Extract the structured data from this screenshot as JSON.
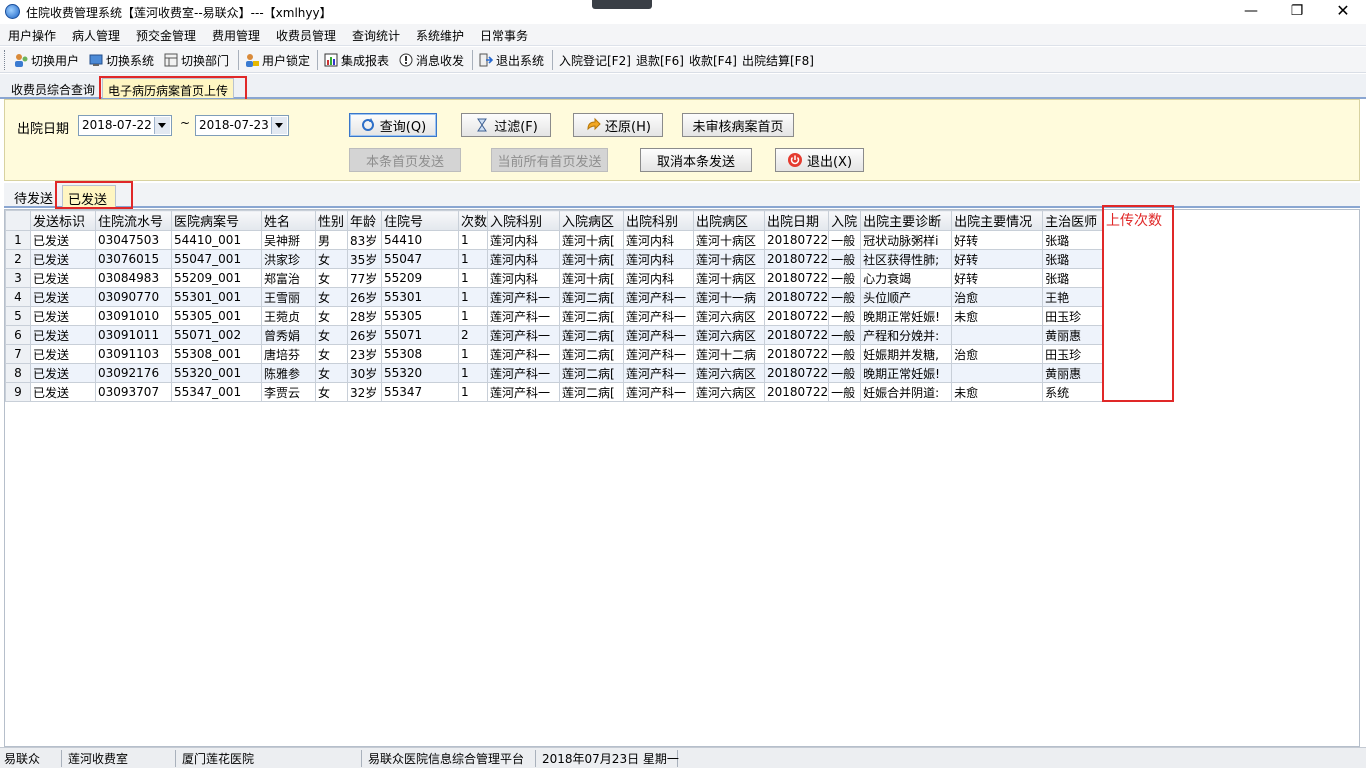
{
  "window": {
    "title": "住院收费管理系统【莲河收费室--易联众】---【xmlhyy】",
    "minimize": "—",
    "maximize": "❐",
    "close": "✕"
  },
  "menu": [
    "用户操作",
    "病人管理",
    "预交金管理",
    "费用管理",
    "收费员管理",
    "查询统计",
    "系统维护",
    "日常事务"
  ],
  "toolbar": [
    {
      "label": "切换用户",
      "icon": "switch-user-icon"
    },
    {
      "label": "切换系统",
      "icon": "switch-system-icon"
    },
    {
      "label": "切换部门",
      "icon": "switch-department-icon"
    },
    {
      "label": "用户锁定",
      "icon": "user-lock-icon"
    },
    {
      "label": "集成报表",
      "icon": "report-icon"
    },
    {
      "label": "消息收发",
      "icon": "message-icon"
    },
    {
      "label": "退出系统",
      "icon": "exit-icon"
    },
    {
      "label": "入院登记[F2]"
    },
    {
      "label": "退款[F6]"
    },
    {
      "label": "收款[F4]"
    },
    {
      "label": "出院结算[F8]"
    }
  ],
  "tabs": [
    "收费员综合查询",
    "电子病历病案首页上传"
  ],
  "filter": {
    "date_label": "出院日期",
    "date_from": "2018-07-22",
    "date_tilde": "~",
    "date_to": "2018-07-23",
    "buttons": {
      "query": "查询(Q)",
      "filter": "过滤(F)",
      "restore": "还原(H)",
      "unreviewed": "未审核病案首页",
      "send_this": "本条首页发送",
      "send_all": "当前所有首页发送",
      "cancel_send": "取消本条发送",
      "exit": "退出(X)"
    }
  },
  "inner_tabs": [
    "待发送",
    "已发送"
  ],
  "grid": {
    "columns": [
      "发送标识",
      "住院流水号",
      "医院病案号",
      "姓名",
      "性别",
      "年龄",
      "住院号",
      "次数",
      "入院科别",
      "入院病区",
      "出院科别",
      "出院病区",
      "出院日期",
      "入院",
      "出院主要诊断",
      "出院主要情况",
      "主治医师"
    ],
    "rows": [
      [
        "1",
        "已发送",
        "03047503",
        "54410_001",
        "吴神掰",
        "男",
        "83岁",
        "54410",
        "1",
        "莲河内科",
        "莲河十病[",
        "莲河内科",
        "莲河十病区",
        "20180722",
        "一般",
        "冠状动脉粥样i",
        "好转",
        "张璐"
      ],
      [
        "2",
        "已发送",
        "03076015",
        "55047_001",
        "洪家珍",
        "女",
        "35岁",
        "55047",
        "1",
        "莲河内科",
        "莲河十病[",
        "莲河内科",
        "莲河十病区",
        "20180722",
        "一般",
        "社区获得性肺;",
        "好转",
        "张璐"
      ],
      [
        "3",
        "已发送",
        "03084983",
        "55209_001",
        "郑富治",
        "女",
        "77岁",
        "55209",
        "1",
        "莲河内科",
        "莲河十病[",
        "莲河内科",
        "莲河十病区",
        "20180722",
        "一般",
        "心力衰竭",
        "好转",
        "张璐"
      ],
      [
        "4",
        "已发送",
        "03090770",
        "55301_001",
        "王雪丽",
        "女",
        "26岁",
        "55301",
        "1",
        "莲河产科一",
        "莲河二病[",
        "莲河产科一",
        "莲河十一病",
        "20180722",
        "一般",
        "头位顺产",
        "治愈",
        "王艳"
      ],
      [
        "5",
        "已发送",
        "03091010",
        "55305_001",
        "王菀贞",
        "女",
        "28岁",
        "55305",
        "1",
        "莲河产科一",
        "莲河二病[",
        "莲河产科一",
        "莲河六病区",
        "20180722",
        "一般",
        "晚期正常妊娠!",
        "未愈",
        "田玉珍"
      ],
      [
        "6",
        "已发送",
        "03091011",
        "55071_002",
        "曾秀娟",
        "女",
        "26岁",
        "55071",
        "2",
        "莲河产科一",
        "莲河二病[",
        "莲河产科一",
        "莲河六病区",
        "20180722",
        "一般",
        "产程和分娩并:",
        "",
        "黄丽惠"
      ],
      [
        "7",
        "已发送",
        "03091103",
        "55308_001",
        "唐培芬",
        "女",
        "23岁",
        "55308",
        "1",
        "莲河产科一",
        "莲河二病[",
        "莲河产科一",
        "莲河十二病",
        "20180722",
        "一般",
        "妊娠期并发糖,",
        "治愈",
        "田玉珍"
      ],
      [
        "8",
        "已发送",
        "03092176",
        "55320_001",
        "陈雅参",
        "女",
        "30岁",
        "55320",
        "1",
        "莲河产科一",
        "莲河二病[",
        "莲河产科一",
        "莲河六病区",
        "20180722",
        "一般",
        "晚期正常妊娠!",
        "",
        "黄丽惠"
      ],
      [
        "9",
        "已发送",
        "03093707",
        "55347_001",
        "李贾云",
        "女",
        "32岁",
        "55347",
        "1",
        "莲河产科一",
        "莲河二病[",
        "莲河产科一",
        "莲河六病区",
        "20180722",
        "一般",
        "妊娠合并阴道:",
        "未愈",
        "系统"
      ]
    ]
  },
  "annotation": "上传次数",
  "statusbar": [
    "易联众",
    "莲河收费室",
    "厦门莲花医院",
    "易联众医院信息综合管理平台",
    "2018年07月23日 星期一"
  ]
}
